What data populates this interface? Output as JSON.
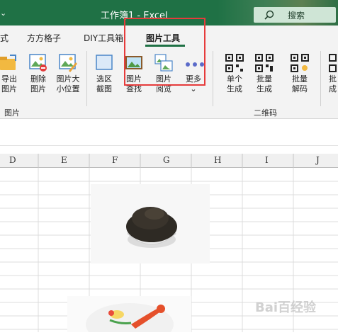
{
  "titlebar": {
    "left_fragment": "⌄",
    "title": "工作簿1 - Excel",
    "search_label": "搜索"
  },
  "tabs": [
    {
      "label": "式"
    },
    {
      "label": "方方格子"
    },
    {
      "label": "DIY工具箱"
    },
    {
      "label": "图片工具",
      "active": true
    }
  ],
  "ribbon": {
    "buttons": [
      {
        "label1": "导出",
        "label2": "图片"
      },
      {
        "label1": "删除",
        "label2": "图片"
      },
      {
        "label1": "图片大",
        "label2": "小位置"
      },
      {
        "label1": "选区",
        "label2": "截图"
      },
      {
        "label1": "图片",
        "label2": "查找"
      },
      {
        "label1": "图片",
        "label2": "阅览"
      },
      {
        "label1": "更多",
        "label2": "⌄"
      },
      {
        "label1": "单个",
        "label2": "生成"
      },
      {
        "label1": "批量",
        "label2": "生成"
      },
      {
        "label1": "批量",
        "label2": "解码"
      },
      {
        "label1": "批",
        "label2": "成"
      }
    ],
    "group_images": "图片",
    "group_qrcode": "二维码"
  },
  "columns": [
    "D",
    "E",
    "F",
    "G",
    "H",
    "I",
    "J"
  ],
  "watermark": "Bai百经验"
}
